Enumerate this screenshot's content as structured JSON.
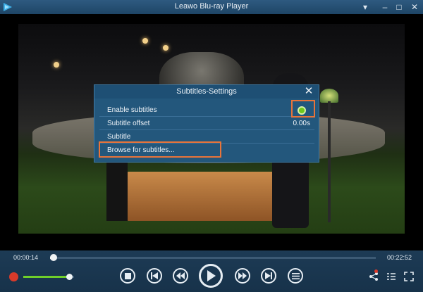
{
  "window": {
    "title": "Leawo Blu-ray Player",
    "controls": [
      "menu-icon",
      "minimize-icon",
      "maximize-icon",
      "close-icon"
    ]
  },
  "dialog": {
    "title": "Subtitles-Settings",
    "rows": [
      {
        "label": "Enable subtitles",
        "control": "toggle",
        "enabled": true
      },
      {
        "label": "Subtitle offset",
        "value": "0.00s"
      },
      {
        "label": "Subtitle"
      },
      {
        "label": "Browse for subtitles..."
      }
    ]
  },
  "playback": {
    "current_time": "00:00:14",
    "duration": "00:22:52",
    "progress_fraction": 0.011,
    "volume_fraction": 0.9
  },
  "colors": {
    "dialog_bg": "#23577c",
    "highlight": "#e8743a",
    "toggle_on": "#6ec81e",
    "volume_fill": "#6fcf2a",
    "mute_icon": "#d83a2a"
  },
  "icons": [
    "app-logo-icon",
    "stop-icon",
    "previous-icon",
    "rewind-icon",
    "play-icon",
    "fast-forward-icon",
    "next-icon",
    "playlist-menu-icon",
    "share-icon",
    "list-icon",
    "fullscreen-icon"
  ]
}
